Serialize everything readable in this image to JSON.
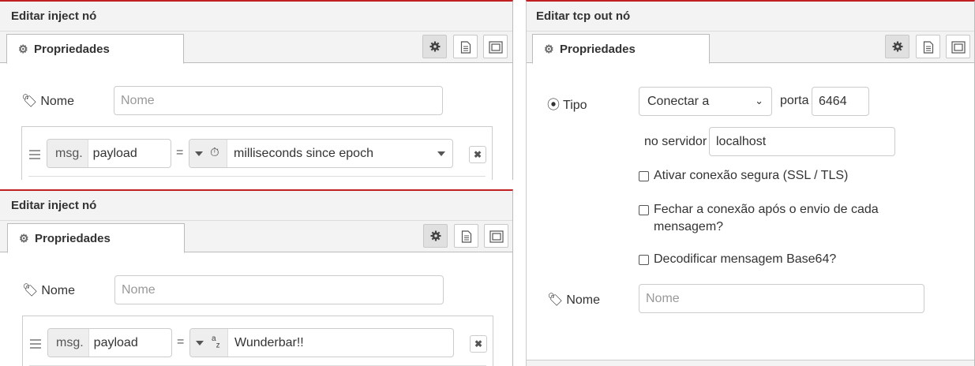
{
  "inject_top": {
    "title": "Editar inject nó",
    "tab_label": "Propriedades",
    "name_label": "Nome",
    "name_placeholder": "Nome",
    "msg_prefix": "msg.",
    "msg_property": "payload",
    "equals": "=",
    "value_type_icon": "clock-icon",
    "value": "milliseconds since epoch"
  },
  "inject_bottom": {
    "title": "Editar inject nó",
    "tab_label": "Propriedades",
    "name_label": "Nome",
    "name_placeholder": "Nome",
    "msg_prefix": "msg.",
    "msg_property": "payload",
    "equals": "=",
    "value_type_icon": "string-az-icon",
    "value": "Wunderbar!!"
  },
  "tcp_out": {
    "title": "Editar tcp out nó",
    "tab_label": "Propriedades",
    "type_label": "Tipo",
    "type_value": "Conectar a",
    "port_label": "porta",
    "port_value": "6464",
    "server_label": "no servidor",
    "server_value": "localhost",
    "tls_label": "Ativar conexão segura (SSL / TLS)",
    "tls_checked": false,
    "close_label_line1": "Fechar a conexão após o envio de cada",
    "close_label_line2": "mensagem?",
    "close_checked": false,
    "base64_label": "Decodificar mensagem Base64?",
    "base64_checked": false,
    "name_label": "Nome",
    "name_placeholder": "Nome"
  },
  "icons": {
    "tab_icon": "gear-icon",
    "toolbar": [
      "gear-icon",
      "document-icon",
      "frame-icon"
    ],
    "name_icon": "tag-icon",
    "type_icon": "target-icon"
  },
  "colors": {
    "header_accent": "#c02020",
    "header_bg": "#f3f3f3"
  }
}
